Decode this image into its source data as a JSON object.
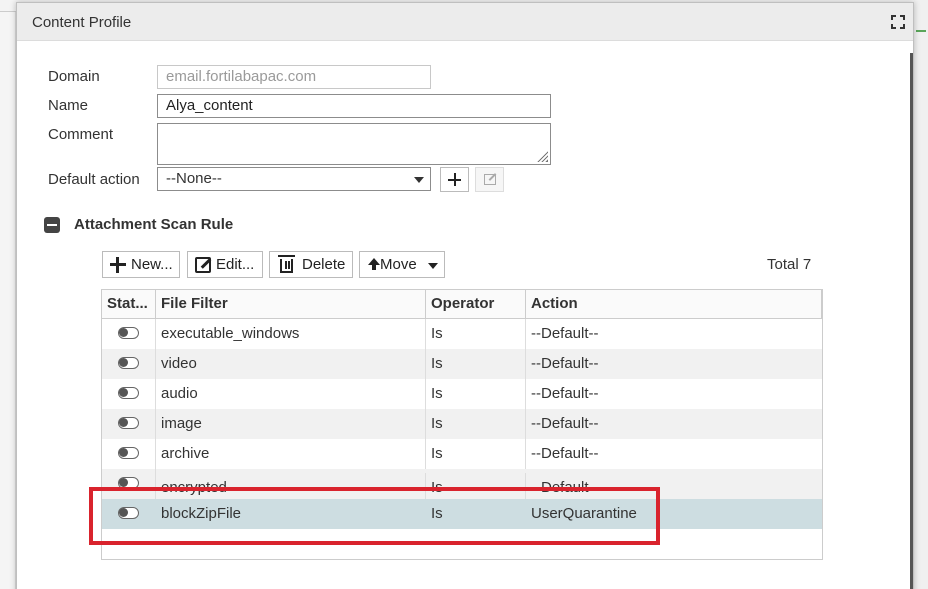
{
  "dialog": {
    "title": "Content Profile"
  },
  "form": {
    "domain_label": "Domain",
    "domain_value": "email.fortilabapac.com",
    "name_label": "Name",
    "name_value": "Alya_content",
    "comment_label": "Comment",
    "comment_value": "",
    "default_action_label": "Default action",
    "default_action_value": "--None--"
  },
  "section": {
    "title": "Attachment Scan Rule"
  },
  "toolbar": {
    "new_label": "New...",
    "edit_label": "Edit...",
    "delete_label": "Delete",
    "move_label": "Move",
    "total_label": "Total 7"
  },
  "table": {
    "headers": [
      "Stat...",
      "File Filter",
      "Operator",
      "Action"
    ],
    "rows": [
      {
        "status": "off",
        "file_filter": "executable_windows",
        "operator": "Is",
        "action": "--Default--"
      },
      {
        "status": "off",
        "file_filter": "video",
        "operator": "Is",
        "action": "--Default--"
      },
      {
        "status": "off",
        "file_filter": "audio",
        "operator": "Is",
        "action": "--Default--"
      },
      {
        "status": "off",
        "file_filter": "image",
        "operator": "Is",
        "action": "--Default--"
      },
      {
        "status": "off",
        "file_filter": "archive",
        "operator": "Is",
        "action": "--Default--"
      },
      {
        "status": "off",
        "file_filter": "encrypted",
        "operator": "Is",
        "action": "--Default--"
      },
      {
        "status": "off",
        "file_filter": "blockZipFile",
        "operator": "Is",
        "action": "UserQuarantine"
      }
    ]
  },
  "colors": {
    "highlight": "#d9232d",
    "selected_row": "#cddde1"
  }
}
